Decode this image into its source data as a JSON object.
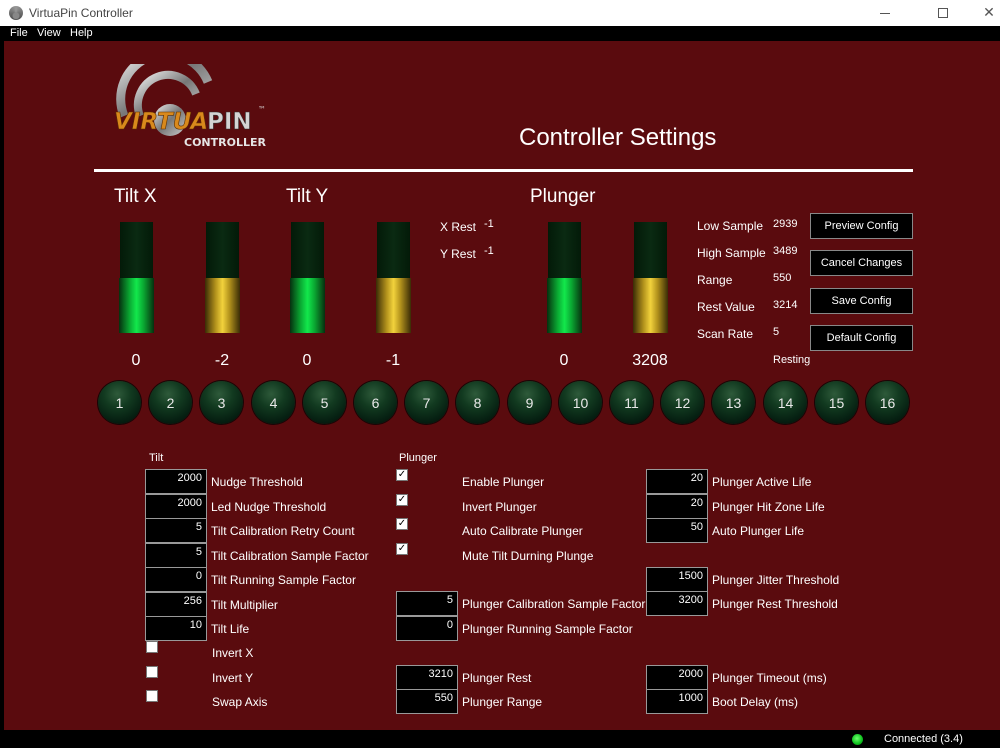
{
  "window": {
    "title": "VirtuaPin Controller",
    "minimize_icon": "minimize-icon",
    "maximize_icon": "maximize-icon",
    "close_icon": "close-icon"
  },
  "menu": [
    "File",
    "View",
    "Help"
  ],
  "logo": {
    "word1": "VIRTUA",
    "word2": "PIN",
    "tm": "™",
    "sub": "CONTROLLER"
  },
  "header": {
    "title": "Controller Settings"
  },
  "tilt_x": {
    "title": "Tilt X",
    "meters": [
      {
        "value": "0",
        "fill": 0.5,
        "color": "green"
      },
      {
        "value": "-2",
        "fill": 0.5,
        "color": "yellow"
      }
    ]
  },
  "tilt_y": {
    "title": "Tilt Y",
    "meters": [
      {
        "value": "0",
        "fill": 0.5,
        "color": "green"
      },
      {
        "value": "-1",
        "fill": 0.5,
        "color": "yellow"
      }
    ]
  },
  "rest": {
    "x_label": "X Rest",
    "x_value": "-1",
    "y_label": "Y Rest",
    "y_value": "-1"
  },
  "plunger_meters": {
    "title": "Plunger",
    "meters": [
      {
        "value": "0",
        "fill": 0.5,
        "color": "green"
      },
      {
        "value": "3208",
        "fill": 0.5,
        "color": "yellow"
      }
    ]
  },
  "stats": [
    {
      "label": "Low Sample",
      "value": "2939"
    },
    {
      "label": "High Sample",
      "value": "3489"
    },
    {
      "label": "Range",
      "value": "550"
    },
    {
      "label": "Rest Value",
      "value": "3214"
    },
    {
      "label": "Scan Rate",
      "value": "5"
    }
  ],
  "plunger_state": "Resting",
  "buttons": [
    "Preview Config",
    "Cancel Changes",
    "Save Config",
    "Default Config"
  ],
  "button_indicators": [
    "1",
    "2",
    "3",
    "4",
    "5",
    "6",
    "7",
    "8",
    "9",
    "10",
    "11",
    "12",
    "13",
    "14",
    "15",
    "16"
  ],
  "tilt_settings": {
    "label": "Tilt",
    "fields": [
      {
        "value": "2000",
        "label": "Nudge Threshold"
      },
      {
        "value": "2000",
        "label": "Led Nudge Threshold"
      },
      {
        "value": "5",
        "label": "Tilt Calibration Retry Count"
      },
      {
        "value": "5",
        "label": "Tilt Calibration Sample Factor"
      },
      {
        "value": "0",
        "label": "Tilt Running Sample Factor"
      },
      {
        "value": "256",
        "label": "Tilt Multiplier"
      },
      {
        "value": "10",
        "label": "Tilt Life"
      }
    ],
    "checkboxes": [
      {
        "label": "Invert X",
        "checked": false
      },
      {
        "label": "Invert Y",
        "checked": false
      },
      {
        "label": "Swap Axis",
        "checked": false
      }
    ]
  },
  "plunger_settings": {
    "label": "Plunger",
    "checkboxes": [
      {
        "label": "Enable Plunger",
        "checked": true
      },
      {
        "label": "Invert Plunger",
        "checked": true
      },
      {
        "label": "Auto Calibrate Plunger",
        "checked": true
      },
      {
        "label": "Mute Tilt Durning Plunge",
        "checked": true
      }
    ],
    "fields_mid": [
      {
        "value": "5",
        "label": "Plunger Calibration Sample Factor"
      },
      {
        "value": "0",
        "label": "Plunger Running Sample Factor"
      },
      {
        "value": "3210",
        "label": "Plunger Rest"
      },
      {
        "value": "550",
        "label": "Plunger Range"
      }
    ],
    "fields_right": [
      {
        "value": "20",
        "label": "Plunger Active Life"
      },
      {
        "value": "20",
        "label": "Plunger Hit Zone Life"
      },
      {
        "value": "50",
        "label": "Auto Plunger Life"
      },
      {
        "value": "1500",
        "label": "Plunger Jitter Threshold"
      },
      {
        "value": "3200",
        "label": "Plunger Rest Threshold"
      },
      {
        "value": "2000",
        "label": "Plunger Timeout (ms)"
      },
      {
        "value": "1000",
        "label": "Boot Delay (ms)"
      }
    ]
  },
  "status": {
    "text": "Connected (3.4)",
    "led_color": "#1ad42e"
  },
  "colors": {
    "background": "#5a0b0e",
    "meter_green": "#12e84c",
    "meter_yellow": "#f2d23c"
  }
}
